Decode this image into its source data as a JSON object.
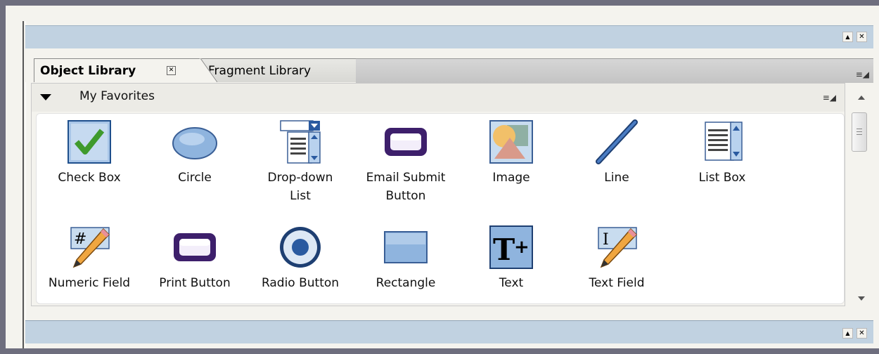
{
  "window": {
    "minimize_glyph": "▲",
    "close_glyph": "✕"
  },
  "tabs": [
    {
      "label": "Object Library",
      "active": true
    },
    {
      "label": "Fragment Library",
      "active": false
    }
  ],
  "tab_close_glyph": "✕",
  "panel_menu_glyph": "≡◢",
  "section": {
    "title": "My Favorites",
    "menu_glyph": "≡◢"
  },
  "objects": [
    {
      "label": "Check Box",
      "icon": "checkbox-icon"
    },
    {
      "label": "Circle",
      "icon": "circle-icon"
    },
    {
      "label": "Drop-down List",
      "icon": "dropdown-list-icon"
    },
    {
      "label": "Email Submit Button",
      "icon": "email-submit-button-icon"
    },
    {
      "label": "Image",
      "icon": "image-icon"
    },
    {
      "label": "Line",
      "icon": "line-icon"
    },
    {
      "label": "List Box",
      "icon": "list-box-icon"
    },
    {
      "label": "Numeric Field",
      "icon": "numeric-field-icon"
    },
    {
      "label": "Print Button",
      "icon": "print-button-icon"
    },
    {
      "label": "Radio Button",
      "icon": "radio-button-icon"
    },
    {
      "label": "Rectangle",
      "icon": "rectangle-icon"
    },
    {
      "label": "Text",
      "icon": "text-icon"
    },
    {
      "label": "Text Field",
      "icon": "text-field-icon"
    }
  ],
  "colors": {
    "panel_bg": "#f4f3ee",
    "titlebar": "#c1d2e1",
    "icon_blue": "#8fb4de",
    "icon_purple": "#3d1f6b"
  }
}
